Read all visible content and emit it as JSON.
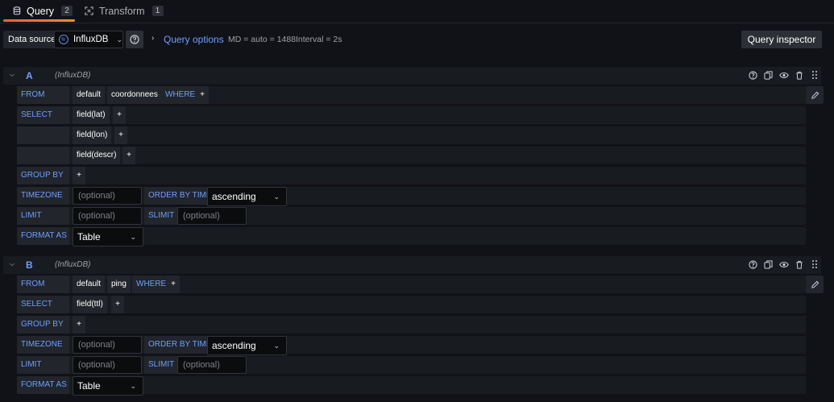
{
  "tabs": [
    {
      "label": "Query",
      "count": "2",
      "icon": "database-icon",
      "active": true
    },
    {
      "label": "Transform",
      "count": "1",
      "icon": "transform-icon",
      "active": false
    }
  ],
  "toolbar": {
    "datasource_label": "Data source",
    "datasource": "InfluxDB",
    "query_options_label": "Query options",
    "md": "MD = auto = 1488",
    "interval": "Interval = 2s",
    "inspector_label": "Query inspector"
  },
  "queries": {
    "a": {
      "ref_id": "A",
      "datasource": "(InfluxDB)",
      "from": {
        "kw": "FROM",
        "policy": "default",
        "measurement": "coordonnees",
        "where": "WHERE",
        "plus": "+"
      },
      "select": {
        "kw": "SELECT",
        "fields": [
          "field(lat)",
          "field(lon)",
          "field(descr)"
        ],
        "plus": "+"
      },
      "group_by": {
        "kw": "GROUP BY",
        "plus": "+"
      },
      "timezone": {
        "kw": "TIMEZONE",
        "placeholder": "(optional)",
        "order_kw": "ORDER BY TIME",
        "order": "ascending"
      },
      "limit": {
        "kw": "LIMIT",
        "placeholder": "(optional)",
        "slimit_kw": "SLIMIT",
        "slimit_placeholder": "(optional)"
      },
      "format": {
        "kw": "FORMAT AS",
        "value": "Table"
      }
    },
    "b": {
      "ref_id": "B",
      "datasource": "(InfluxDB)",
      "from": {
        "kw": "FROM",
        "policy": "default",
        "measurement": "ping",
        "where": "WHERE",
        "plus": "+"
      },
      "select": {
        "kw": "SELECT",
        "fields": [
          "field(ttl)"
        ],
        "plus": "+"
      },
      "group_by": {
        "kw": "GROUP BY",
        "plus": "+"
      },
      "timezone": {
        "kw": "TIMEZONE",
        "placeholder": "(optional)",
        "order_kw": "ORDER BY TIME",
        "order": "ascending"
      },
      "limit": {
        "kw": "LIMIT",
        "placeholder": "(optional)",
        "slimit_kw": "SLIMIT",
        "slimit_placeholder": "(optional)"
      },
      "format": {
        "kw": "FORMAT AS",
        "value": "Table"
      }
    }
  },
  "colors": {
    "accent_blue": "#6e9fff",
    "tab_underline": "#f55f3e",
    "background": "#111217",
    "panel": "#181b1f",
    "segment": "#22252b"
  }
}
